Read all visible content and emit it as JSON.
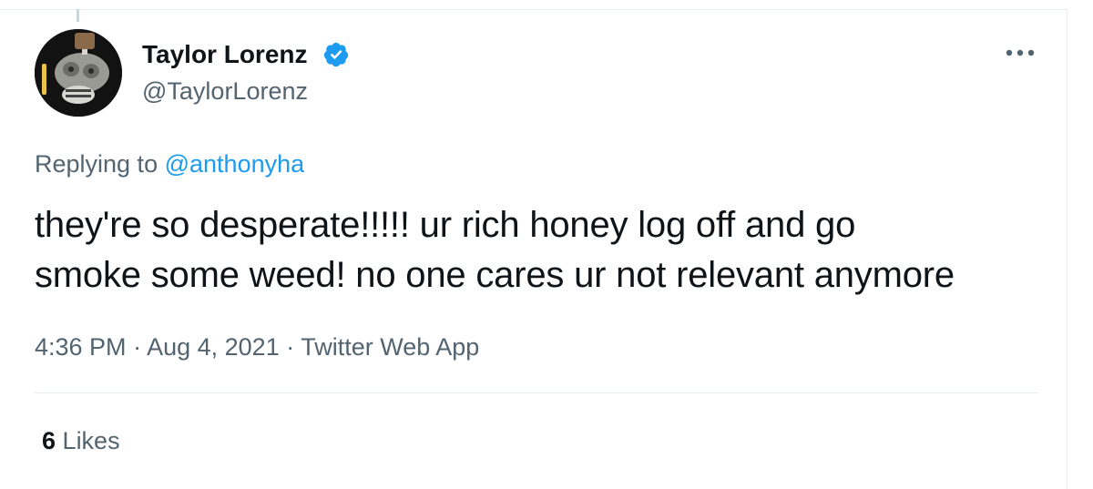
{
  "author": {
    "display_name": "Taylor Lorenz",
    "handle": "@TaylorLorenz",
    "verified": true,
    "avatar_icon": "profile-photo-avatar"
  },
  "menu_icon": "more-options-icon",
  "reply": {
    "prefix": "Replying to",
    "mention": "@anthonyha"
  },
  "tweet": {
    "line1": "they're so desperate!!!!! ur rich honey log off and go",
    "line2": "smoke some weed! no one cares ur not relevant anymore"
  },
  "meta": {
    "time": "4:36 PM",
    "sep1": " · ",
    "date": "Aug 4, 2021",
    "sep2": " · ",
    "source": "Twitter Web App"
  },
  "engagement": {
    "likes_count": "6",
    "likes_label": "Likes"
  },
  "colors": {
    "accent": "#1d9bf0",
    "text_primary": "#0f1419",
    "text_secondary": "#536471",
    "border": "#e6ecf0"
  }
}
